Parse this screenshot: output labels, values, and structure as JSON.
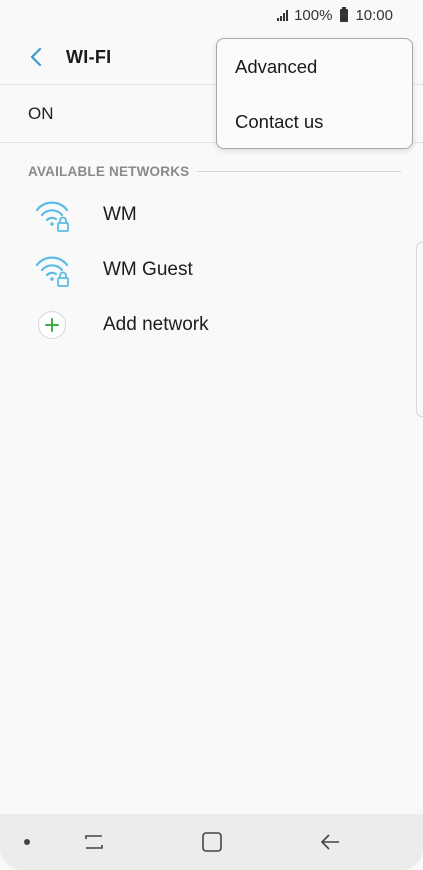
{
  "status_bar": {
    "battery": "100%",
    "time": "10:00"
  },
  "header": {
    "title": "WI-FI",
    "back_icon": "chevron-left-icon"
  },
  "toggle": {
    "label": "ON"
  },
  "section": {
    "label": "AVAILABLE NETWORKS"
  },
  "networks": [
    {
      "label": "WM",
      "icon": "wifi-locked-icon"
    },
    {
      "label": "WM Guest",
      "icon": "wifi-locked-icon"
    }
  ],
  "add_network": {
    "label": "Add network",
    "icon": "plus-icon"
  },
  "menu": {
    "items": [
      {
        "label": "Advanced"
      },
      {
        "label": "Contact us"
      }
    ]
  },
  "nav_bar": {
    "buttons": [
      "dot-icon",
      "recents-icon",
      "home-icon",
      "back-arrow-icon"
    ]
  },
  "colors": {
    "wifi_icon": "#5bbde4",
    "back_chevron": "#3a9bc7",
    "plus_icon": "#3cb043",
    "background": "#f9f9f9"
  }
}
